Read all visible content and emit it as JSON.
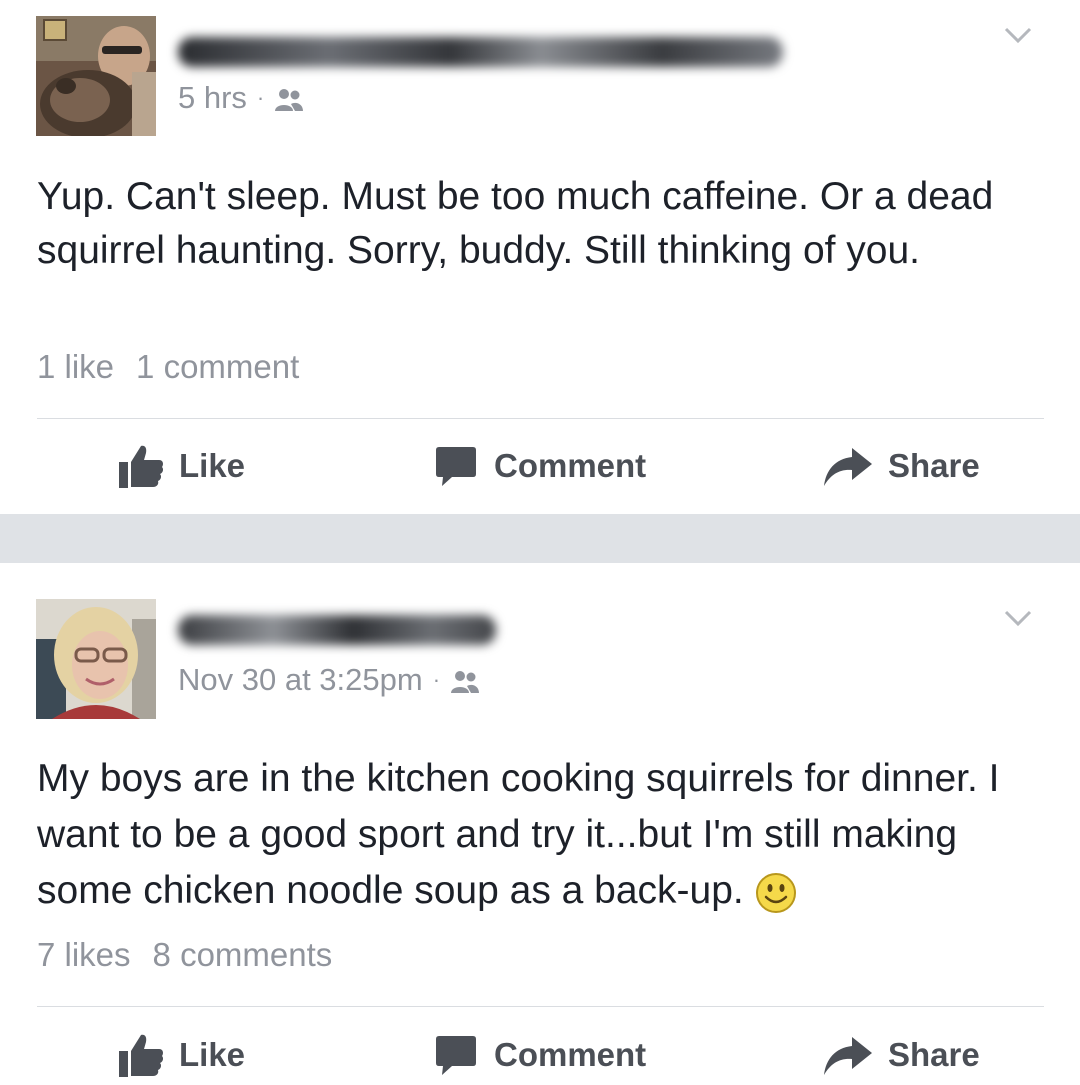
{
  "posts": [
    {
      "timestamp": "5 hrs",
      "body": "Yup. Can't sleep. Must be too much caffeine. Or a dead squirrel haunting. Sorry, buddy. Still thinking of you.",
      "likes": "1 like",
      "comments": "1 comment",
      "actions": {
        "like": "Like",
        "comment": "Comment",
        "share": "Share"
      }
    },
    {
      "timestamp": "Nov 30 at 3:25pm",
      "body": "My boys are in the kitchen cooking squirrels for dinner. I want to be a good sport and try it...but I'm still making some chicken noodle soup as a back-up.",
      "likes": "7 likes",
      "comments": "8 comments",
      "actions": {
        "like": "Like",
        "comment": "Comment",
        "share": "Share"
      }
    }
  ],
  "separator": "·",
  "colors": {
    "text": "#1d2129",
    "meta": "#90949c",
    "action": "#4b4f56",
    "divider": "#dadde1",
    "separator_band": "#dfe2e6"
  },
  "icons": [
    "chevron-down-icon",
    "friends-audience-icon",
    "thumbs-up-icon",
    "comment-bubble-icon",
    "share-arrow-icon",
    "smiley-emoji-icon"
  ]
}
